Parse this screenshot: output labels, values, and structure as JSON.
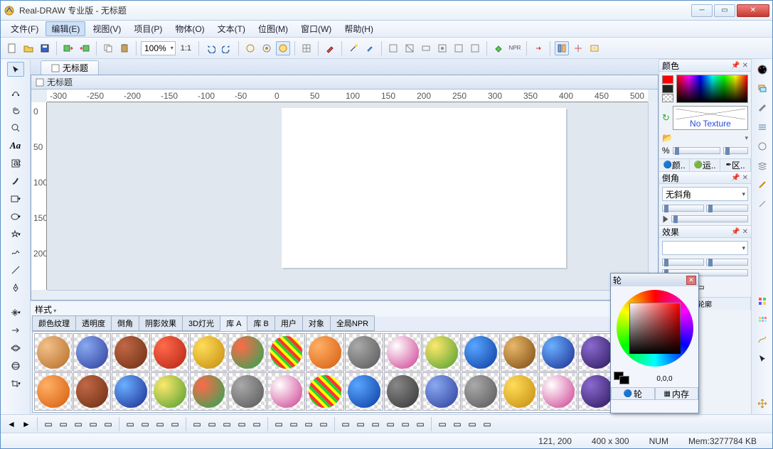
{
  "title": "Real-DRAW 专业版 - 无标题",
  "menus": [
    "文件(F)",
    "编辑(E)",
    "视图(V)",
    "项目(P)",
    "物体(O)",
    "文本(T)",
    "位图(M)",
    "窗口(W)",
    "帮助(H)"
  ],
  "active_menu_index": 1,
  "toolbar": {
    "zoom": "100%",
    "ratio": "1:1"
  },
  "document": {
    "tab": "无标题",
    "inner_title": "无标题"
  },
  "ruler_h": [
    "-300",
    "-250",
    "-200",
    "-150",
    "-100",
    "-50",
    "0",
    "50",
    "100",
    "150",
    "200",
    "250",
    "300",
    "350",
    "400",
    "450",
    "500"
  ],
  "ruler_v": [
    "0",
    "50",
    "100",
    "150",
    "200"
  ],
  "styles": {
    "title": "样式",
    "tabs": [
      "颜色纹理",
      "透明度",
      "倒角",
      "阴影效果",
      "3D灯光",
      "库 A",
      "库 B",
      "用户",
      "对象",
      "全局NPR"
    ],
    "active_tab_index": 5
  },
  "right": {
    "color_title": "颜色",
    "no_texture": "No Texture",
    "percent": "%",
    "color_tabs": [
      "颜..",
      "运..",
      "区.."
    ],
    "bevel_title": "倒角",
    "bevel_value": "无斜角",
    "effect_title": "效果",
    "outline_title": "轮廓"
  },
  "float": {
    "title": "轮",
    "rgb": "0,0,0",
    "tabs": [
      "轮",
      "内存"
    ]
  },
  "status": {
    "pos": "121, 200",
    "size": "400 x 300",
    "num": "NUM",
    "mem": "Mem:3277784 KB"
  }
}
